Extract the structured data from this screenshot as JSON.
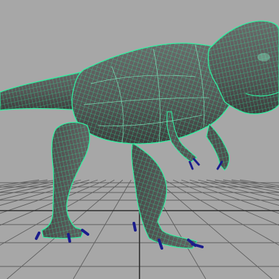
{
  "viewport": {
    "colors": {
      "background": "#a7a7a7",
      "grid_line": "#5c5c5c",
      "grid_axis": "#2c2c2c",
      "mesh_body": "#595959",
      "mesh_shadow": "#3f3f3f",
      "wire": "#2ff0a0",
      "wire_light": "#8bffd0",
      "claw": "#1b1d8c"
    },
    "model_icon": "t-rex-wireframe-mesh",
    "selection_state": "selected"
  }
}
